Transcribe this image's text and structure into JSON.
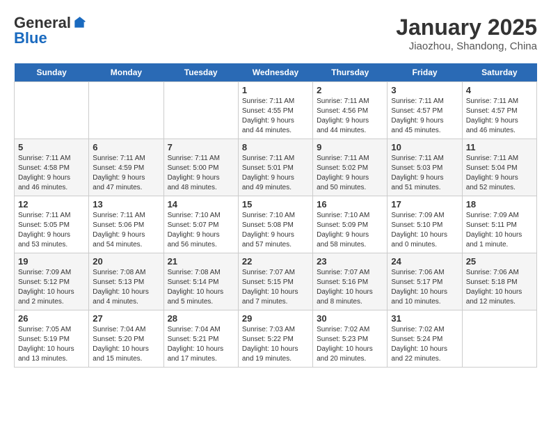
{
  "logo": {
    "general": "General",
    "blue": "Blue"
  },
  "header": {
    "title": "January 2025",
    "subtitle": "Jiaozhou, Shandong, China"
  },
  "days": [
    "Sunday",
    "Monday",
    "Tuesday",
    "Wednesday",
    "Thursday",
    "Friday",
    "Saturday"
  ],
  "weeks": [
    [
      {
        "date": "",
        "info": ""
      },
      {
        "date": "",
        "info": ""
      },
      {
        "date": "",
        "info": ""
      },
      {
        "date": "1",
        "info": "Sunrise: 7:11 AM\nSunset: 4:55 PM\nDaylight: 9 hours\nand 44 minutes."
      },
      {
        "date": "2",
        "info": "Sunrise: 7:11 AM\nSunset: 4:56 PM\nDaylight: 9 hours\nand 44 minutes."
      },
      {
        "date": "3",
        "info": "Sunrise: 7:11 AM\nSunset: 4:57 PM\nDaylight: 9 hours\nand 45 minutes."
      },
      {
        "date": "4",
        "info": "Sunrise: 7:11 AM\nSunset: 4:57 PM\nDaylight: 9 hours\nand 46 minutes."
      }
    ],
    [
      {
        "date": "5",
        "info": "Sunrise: 7:11 AM\nSunset: 4:58 PM\nDaylight: 9 hours\nand 46 minutes."
      },
      {
        "date": "6",
        "info": "Sunrise: 7:11 AM\nSunset: 4:59 PM\nDaylight: 9 hours\nand 47 minutes."
      },
      {
        "date": "7",
        "info": "Sunrise: 7:11 AM\nSunset: 5:00 PM\nDaylight: 9 hours\nand 48 minutes."
      },
      {
        "date": "8",
        "info": "Sunrise: 7:11 AM\nSunset: 5:01 PM\nDaylight: 9 hours\nand 49 minutes."
      },
      {
        "date": "9",
        "info": "Sunrise: 7:11 AM\nSunset: 5:02 PM\nDaylight: 9 hours\nand 50 minutes."
      },
      {
        "date": "10",
        "info": "Sunrise: 7:11 AM\nSunset: 5:03 PM\nDaylight: 9 hours\nand 51 minutes."
      },
      {
        "date": "11",
        "info": "Sunrise: 7:11 AM\nSunset: 5:04 PM\nDaylight: 9 hours\nand 52 minutes."
      }
    ],
    [
      {
        "date": "12",
        "info": "Sunrise: 7:11 AM\nSunset: 5:05 PM\nDaylight: 9 hours\nand 53 minutes."
      },
      {
        "date": "13",
        "info": "Sunrise: 7:11 AM\nSunset: 5:06 PM\nDaylight: 9 hours\nand 54 minutes."
      },
      {
        "date": "14",
        "info": "Sunrise: 7:10 AM\nSunset: 5:07 PM\nDaylight: 9 hours\nand 56 minutes."
      },
      {
        "date": "15",
        "info": "Sunrise: 7:10 AM\nSunset: 5:08 PM\nDaylight: 9 hours\nand 57 minutes."
      },
      {
        "date": "16",
        "info": "Sunrise: 7:10 AM\nSunset: 5:09 PM\nDaylight: 9 hours\nand 58 minutes."
      },
      {
        "date": "17",
        "info": "Sunrise: 7:09 AM\nSunset: 5:10 PM\nDaylight: 10 hours\nand 0 minutes."
      },
      {
        "date": "18",
        "info": "Sunrise: 7:09 AM\nSunset: 5:11 PM\nDaylight: 10 hours\nand 1 minute."
      }
    ],
    [
      {
        "date": "19",
        "info": "Sunrise: 7:09 AM\nSunset: 5:12 PM\nDaylight: 10 hours\nand 2 minutes."
      },
      {
        "date": "20",
        "info": "Sunrise: 7:08 AM\nSunset: 5:13 PM\nDaylight: 10 hours\nand 4 minutes."
      },
      {
        "date": "21",
        "info": "Sunrise: 7:08 AM\nSunset: 5:14 PM\nDaylight: 10 hours\nand 5 minutes."
      },
      {
        "date": "22",
        "info": "Sunrise: 7:07 AM\nSunset: 5:15 PM\nDaylight: 10 hours\nand 7 minutes."
      },
      {
        "date": "23",
        "info": "Sunrise: 7:07 AM\nSunset: 5:16 PM\nDaylight: 10 hours\nand 8 minutes."
      },
      {
        "date": "24",
        "info": "Sunrise: 7:06 AM\nSunset: 5:17 PM\nDaylight: 10 hours\nand 10 minutes."
      },
      {
        "date": "25",
        "info": "Sunrise: 7:06 AM\nSunset: 5:18 PM\nDaylight: 10 hours\nand 12 minutes."
      }
    ],
    [
      {
        "date": "26",
        "info": "Sunrise: 7:05 AM\nSunset: 5:19 PM\nDaylight: 10 hours\nand 13 minutes."
      },
      {
        "date": "27",
        "info": "Sunrise: 7:04 AM\nSunset: 5:20 PM\nDaylight: 10 hours\nand 15 minutes."
      },
      {
        "date": "28",
        "info": "Sunrise: 7:04 AM\nSunset: 5:21 PM\nDaylight: 10 hours\nand 17 minutes."
      },
      {
        "date": "29",
        "info": "Sunrise: 7:03 AM\nSunset: 5:22 PM\nDaylight: 10 hours\nand 19 minutes."
      },
      {
        "date": "30",
        "info": "Sunrise: 7:02 AM\nSunset: 5:23 PM\nDaylight: 10 hours\nand 20 minutes."
      },
      {
        "date": "31",
        "info": "Sunrise: 7:02 AM\nSunset: 5:24 PM\nDaylight: 10 hours\nand 22 minutes."
      },
      {
        "date": "",
        "info": ""
      }
    ]
  ]
}
